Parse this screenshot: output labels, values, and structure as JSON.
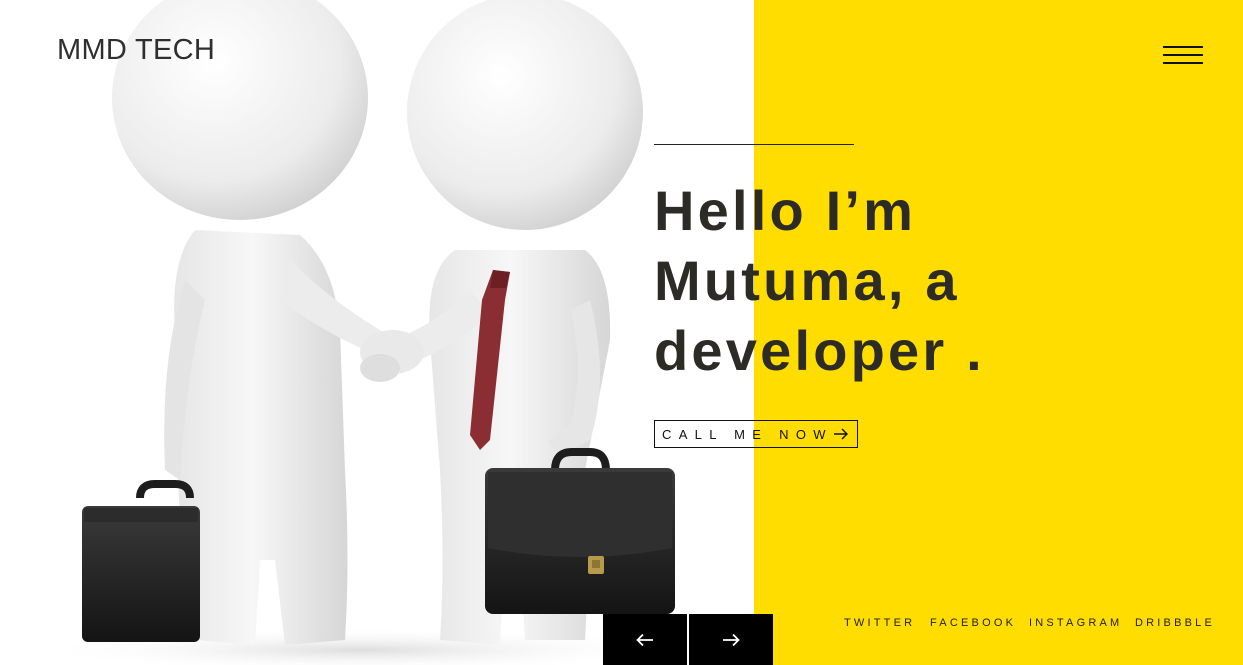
{
  "brand": {
    "name": "MMD TECH"
  },
  "nav": {
    "menu_icon": "hamburger-menu-icon"
  },
  "hero": {
    "heading_lines": [
      "Hello I’m",
      "Mutuma, a",
      "developer ."
    ],
    "cta_label": "CALL ME NOW",
    "cta_icon": "arrow-right-icon",
    "image_subject": "two figures shaking hands holding briefcases"
  },
  "slider": {
    "prev_icon": "arrow-left-icon",
    "next_icon": "arrow-right-icon"
  },
  "social": [
    "TWITTER",
    "FACEBOOK",
    "INSTAGRAM",
    "DRIBBBLE"
  ],
  "colors": {
    "accent": "#FFDD00",
    "background": "#FFFFFF",
    "text": "#2D2B26",
    "button": "#000000"
  }
}
